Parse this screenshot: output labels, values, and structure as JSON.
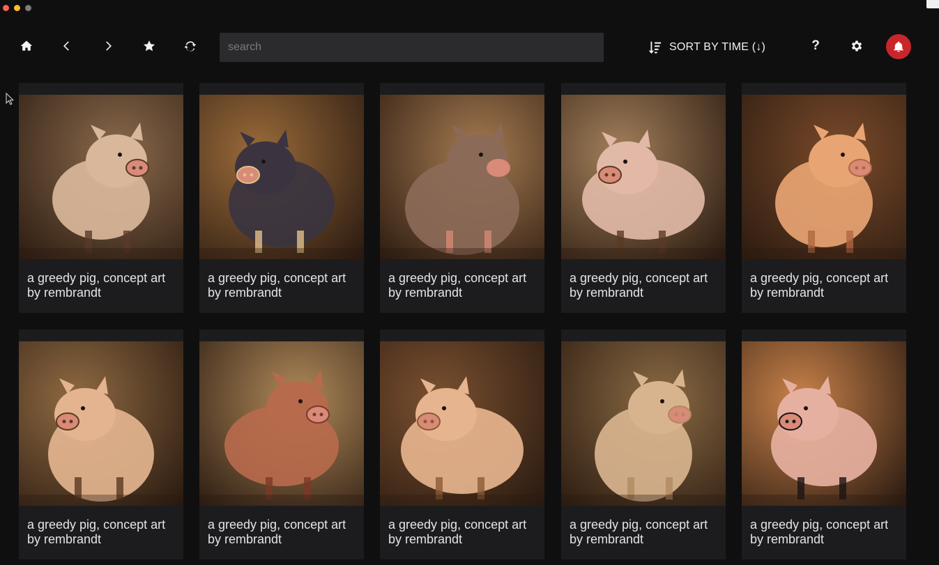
{
  "window": {
    "controls": [
      "close",
      "minimize",
      "maximize"
    ]
  },
  "toolbar": {
    "icons": [
      "home-icon",
      "back-icon",
      "forward-icon",
      "star-icon",
      "refresh-icon"
    ],
    "search_placeholder": "search",
    "sort_label": "SORT BY TIME (↓)",
    "sort_icon": "sort-descending-icon",
    "help_label": "?",
    "settings_icon": "gear-icon",
    "notifications_icon": "bell-icon",
    "notification_color": "#c8262b"
  },
  "gallery": {
    "items": [
      {
        "caption": "a greedy pig, concept art by rembrandt",
        "bg": "#8a6a4c",
        "body": "#d9b79a",
        "accent": "#5a3a28"
      },
      {
        "caption": "a greedy pig, concept art by rembrandt",
        "bg": "#9a6b3a",
        "body": "#3b3440",
        "accent": "#e0c08a"
      },
      {
        "caption": "a greedy pig, concept art by rembrandt",
        "bg": "#a57a50",
        "body": "#8b6a58",
        "accent": "#d68a74"
      },
      {
        "caption": "a greedy pig, concept art by rembrandt",
        "bg": "#a27f5a",
        "body": "#e1b9a6",
        "accent": "#5a3a24"
      },
      {
        "caption": "a greedy pig, concept art by rembrandt",
        "bg": "#7a4a2a",
        "body": "#e8a473",
        "accent": "#b0683e"
      },
      {
        "caption": "a greedy pig, concept art by rembrandt",
        "bg": "#8f6a42",
        "body": "#e3b48f",
        "accent": "#5a3a20"
      },
      {
        "caption": "a greedy pig, concept art by rembrandt",
        "bg": "#b08a5a",
        "body": "#b76a4c",
        "accent": "#7a3a28"
      },
      {
        "caption": "a greedy pig, concept art by rembrandt",
        "bg": "#7a5030",
        "body": "#e6b48e",
        "accent": "#8a5a34"
      },
      {
        "caption": "a greedy pig, concept art by rembrandt",
        "bg": "#8a6a44",
        "body": "#d8b48e",
        "accent": "#b08a60"
      },
      {
        "caption": "a greedy pig, concept art by rembrandt",
        "bg": "#c9824a",
        "body": "#e6b0a0",
        "accent": "#1a1414"
      }
    ]
  }
}
